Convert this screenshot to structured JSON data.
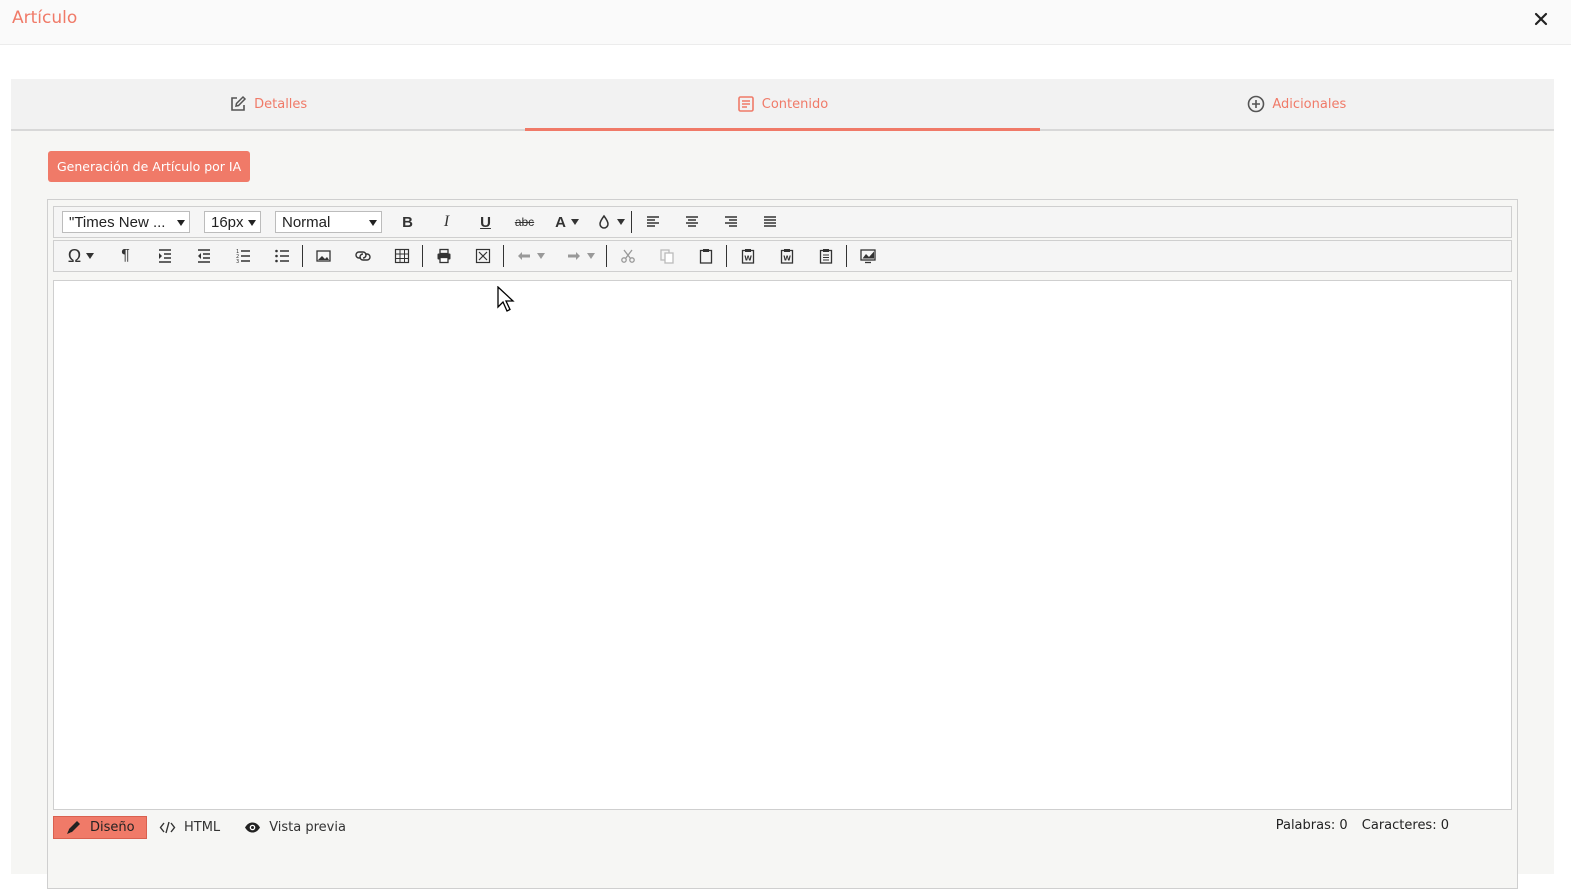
{
  "header": {
    "title": "Artículo",
    "close_icon": "close-icon"
  },
  "tabs": [
    {
      "label": "Detalles",
      "icon": "edit-icon",
      "active": false
    },
    {
      "label": "Contenido",
      "icon": "document-icon",
      "active": true
    },
    {
      "label": "Adicionales",
      "icon": "plus-circle-icon",
      "active": false
    }
  ],
  "ai_button": {
    "label": "Generación de Artículo por IA"
  },
  "toolbar": {
    "font_family": "\"Times New ...",
    "font_size": "16px",
    "format": "Normal",
    "bold": "B",
    "italic": "I",
    "underline": "U",
    "strikethrough": "abc",
    "font_color": "A"
  },
  "bottom": {
    "mode_design": "Diseño",
    "mode_html": "HTML",
    "mode_preview": "Vista previa",
    "words": "Palabras: 0",
    "chars": "Caracteres: 0"
  },
  "colors": {
    "accent": "#f07a68"
  }
}
